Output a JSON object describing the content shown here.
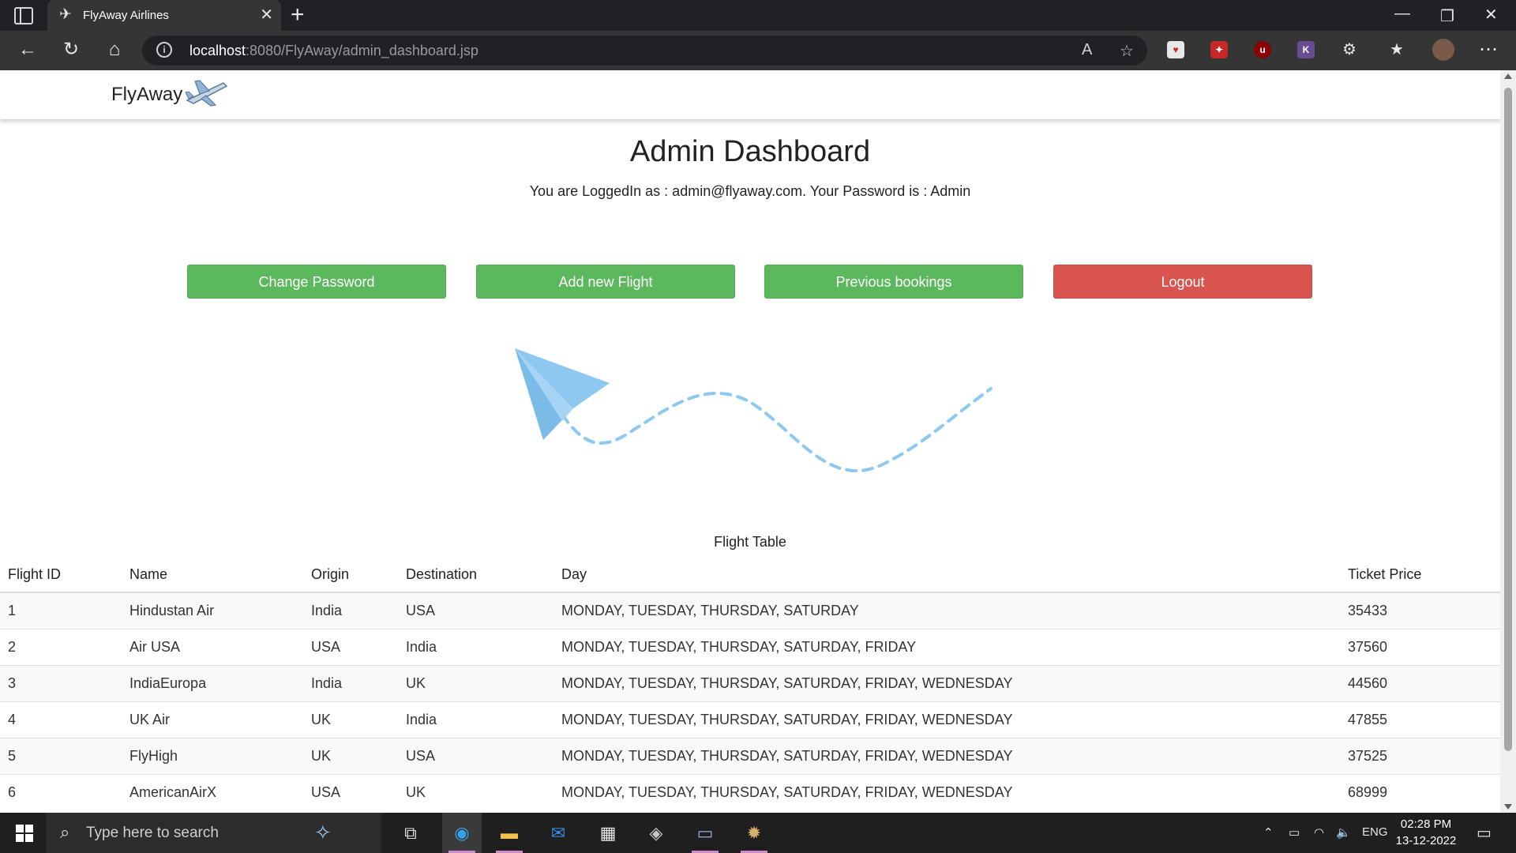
{
  "browser": {
    "tab_title": "FlyAway Airlines",
    "url_host": "localhost",
    "url_path": ":8080/FlyAway/admin_dashboard.jsp"
  },
  "navbar": {
    "brand": "FlyAway"
  },
  "dashboard": {
    "title": "Admin Dashboard",
    "subtitle": "You are LoggedIn as : admin@flyaway.com. Your Password is : Admin"
  },
  "buttons": {
    "change_password": "Change Password",
    "add_flight": "Add new Flight",
    "previous_bookings": "Previous bookings",
    "logout": "Logout"
  },
  "colors": {
    "green": "#5cb85c",
    "red": "#d9534f",
    "plane": "#8cc8f0"
  },
  "table": {
    "caption": "Flight Table",
    "headers": [
      "Flight ID",
      "Name",
      "Origin",
      "Destination",
      "Day",
      "Ticket Price"
    ],
    "rows": [
      [
        "1",
        "Hindustan Air",
        "India",
        "USA",
        "MONDAY, TUESDAY, THURSDAY, SATURDAY",
        "35433"
      ],
      [
        "2",
        "Air USA",
        "USA",
        "India",
        "MONDAY, TUESDAY, THURSDAY, SATURDAY, FRIDAY",
        "37560"
      ],
      [
        "3",
        "IndiaEuropa",
        "India",
        "UK",
        "MONDAY, TUESDAY, THURSDAY, SATURDAY, FRIDAY, WEDNESDAY",
        "44560"
      ],
      [
        "4",
        "UK Air",
        "UK",
        "India",
        "MONDAY, TUESDAY, THURSDAY, SATURDAY, FRIDAY, WEDNESDAY",
        "47855"
      ],
      [
        "5",
        "FlyHigh",
        "UK",
        "USA",
        "MONDAY, TUESDAY, THURSDAY, SATURDAY, FRIDAY, WEDNESDAY",
        "37525"
      ],
      [
        "6",
        "AmericanAirX",
        "USA",
        "UK",
        "MONDAY, TUESDAY, THURSDAY, SATURDAY, FRIDAY, WEDNESDAY",
        "68999"
      ]
    ]
  },
  "taskbar": {
    "search_placeholder": "Type here to search",
    "language": "ENG",
    "time": "02:28 PM",
    "date": "13-12-2022"
  }
}
